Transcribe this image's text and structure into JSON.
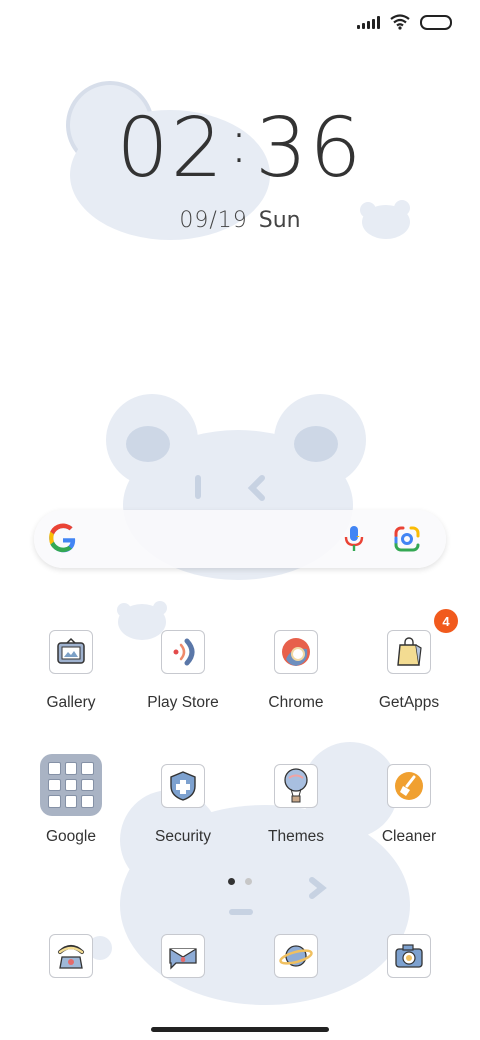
{
  "status_bar": {
    "icons": [
      "signal-icon",
      "wifi-icon",
      "battery-icon"
    ]
  },
  "clock": {
    "hours": "02",
    "separator": ":",
    "minutes": "36",
    "date": "09/19",
    "weekday": "Sun"
  },
  "search_bar": {
    "icons": [
      "google-logo-icon",
      "microphone-icon",
      "google-lens-icon"
    ]
  },
  "apps": [
    {
      "label": "Gallery",
      "icon": "gallery-icon"
    },
    {
      "label": "Play Store",
      "icon": "play-store-icon"
    },
    {
      "label": "Chrome",
      "icon": "chrome-icon"
    },
    {
      "label": "GetApps",
      "icon": "getapps-icon",
      "badge": "4"
    },
    {
      "label": "Google",
      "icon": "folder-icon"
    },
    {
      "label": "Security",
      "icon": "security-icon"
    },
    {
      "label": "Themes",
      "icon": "themes-icon"
    },
    {
      "label": "Cleaner",
      "icon": "cleaner-icon"
    }
  ],
  "dock": [
    {
      "icon": "phone-icon"
    },
    {
      "icon": "messages-icon"
    },
    {
      "icon": "browser-icon"
    },
    {
      "icon": "camera-icon"
    }
  ],
  "page_indicator": {
    "pages": 2,
    "active": 1
  },
  "colors": {
    "badge": "#f15a1d",
    "wallpaper_bear": "#e6ebf3",
    "folder": "#a9b3c4"
  }
}
